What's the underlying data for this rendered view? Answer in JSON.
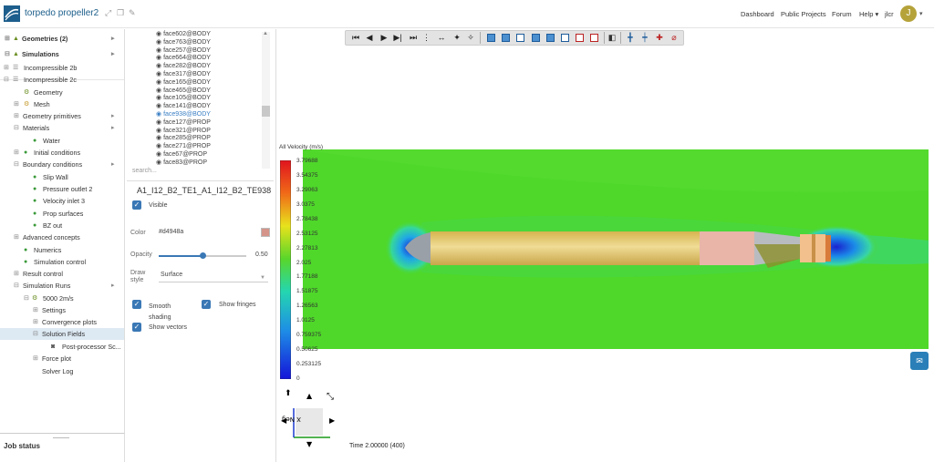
{
  "header": {
    "project_title": "torpedo propeller2",
    "icons": [
      "share-icon",
      "copy-icon",
      "edit-icon"
    ],
    "nav": [
      "Dashboard",
      "Public Projects",
      "Forum",
      "Help"
    ],
    "user_name": "jlcr",
    "avatar_initial": "J"
  },
  "tree": {
    "geometries": {
      "label": "Geometries (2)"
    },
    "simulations": {
      "label": "Simulations"
    },
    "items": {
      "inc2b": "Incompressible 2b",
      "inc2c": "Incompressible 2c",
      "geometry": "Geometry",
      "mesh": "Mesh",
      "geom_primitives": "Geometry primitives",
      "materials": "Materials",
      "water": "Water",
      "initial_conditions": "Initial conditions",
      "boundary_conditions": "Boundary conditions",
      "slip_wall": "Slip Wall",
      "pressure_outlet": "Pressure outlet 2",
      "velocity_inlet": "Velocity inlet 3",
      "prop_surfaces": "Prop surfaces",
      "bz_out": "BZ out",
      "advanced_concepts": "Advanced concepts",
      "numerics": "Numerics",
      "simulation_control": "Simulation control",
      "result_control": "Result control",
      "simulation_runs": "Simulation Runs",
      "run_5000": "5000 2m/s",
      "settings": "Settings",
      "convergence_plots": "Convergence plots",
      "solution_fields": "Solution Fields",
      "post_processor": "Post-processor Sc...",
      "force_plot": "Force plot",
      "solver_log": "Solver Log"
    },
    "job_status": "Job status"
  },
  "faces": {
    "items": [
      "face602@BODY",
      "face763@BODY",
      "face257@BODY",
      "face664@BODY",
      "face282@BODY",
      "face317@BODY",
      "face165@BODY",
      "face465@BODY",
      "face105@BODY",
      "face141@BODY",
      "face938@BODY",
      "face127@PROP",
      "face321@PROP",
      "face285@PROP",
      "face271@PROP",
      "face67@PROP",
      "face83@PROP"
    ],
    "selected_index": 10,
    "search_placeholder": "search..."
  },
  "props": {
    "title": "A1_I12_B2_TE1_A1_I12_B2_TE938",
    "visible_label": "Visible",
    "color_label": "Color",
    "color_value": "#d4948a",
    "opacity_label": "Opacity",
    "opacity_value": "0.50",
    "draw_style_label": "Draw style",
    "draw_style_value": "Surface",
    "smooth_shading_label": "Smooth shading",
    "show_fringes_label": "Show fringes",
    "show_vectors_label": "Show vectors"
  },
  "viewer": {
    "legend_title": "All Velocity (m/s)",
    "legend_values": [
      "3.79688",
      "3.54375",
      "3.29063",
      "3.0375",
      "2.78438",
      "2.53125",
      "2.27813",
      "2.025",
      "1.77188",
      "1.51875",
      "1.26563",
      "1.0125",
      "0.759375",
      "0.50625",
      "0.253125",
      "0"
    ],
    "time_text": "Time 2.00000 (400)",
    "triad_label": "X Neg",
    "colors": {
      "fluid": "#4fd82a",
      "hull": "#e6cf73",
      "accent": "#3a78b5"
    }
  }
}
